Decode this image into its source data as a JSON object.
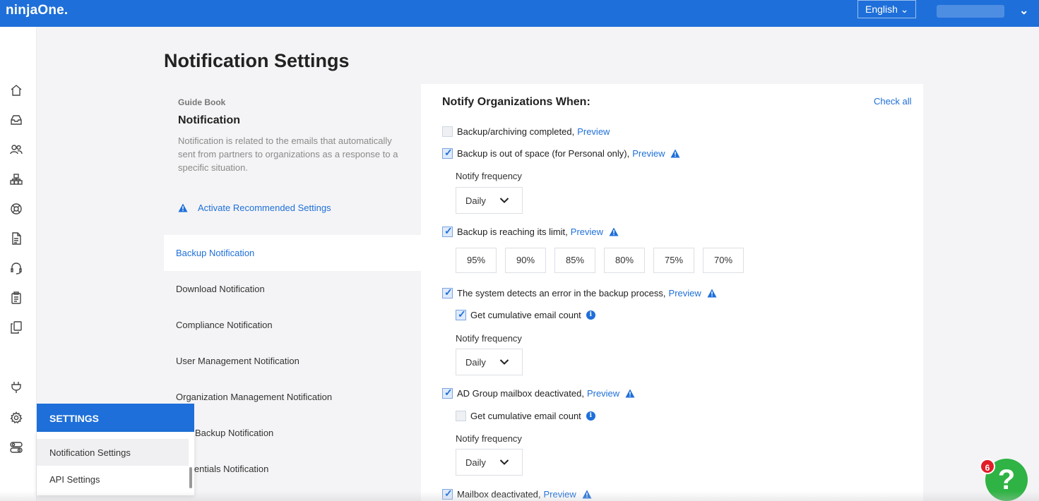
{
  "app": {
    "logo": "ninjaOne."
  },
  "header": {
    "language": "English ⌄"
  },
  "page": {
    "title": "Notification Settings"
  },
  "guide": {
    "label": "Guide Book",
    "heading": "Notification",
    "description": "Notification is related to the emails that automatically sent from partners to organizations as a response to a specific situation.",
    "activate_link": "Activate Recommended Settings"
  },
  "categories": [
    {
      "label": "Backup Notification",
      "active": true
    },
    {
      "label": "Download Notification"
    },
    {
      "label": "Compliance Notification"
    },
    {
      "label": "User Management Notification"
    },
    {
      "label": "Organization Management Notification"
    },
    {
      "label": "Backup Notification"
    },
    {
      "label": "lentials Notification"
    }
  ],
  "panel": {
    "title": "Notify Organizations When:",
    "check_all": "Check all",
    "preview": "Preview",
    "items": {
      "archiving": "Backup/archiving completed,",
      "out_of_space": "Backup is out of space (for Personal only),",
      "reaching_limit": "Backup is reaching its limit,",
      "error_detected": "The system detects an error in the backup process,",
      "cumulative": "Get cumulative email count",
      "ad_group": "AD Group mailbox deactivated,",
      "cumulative2": "Get cumulative email count",
      "mailbox": "Mailbox deactivated,"
    },
    "notify_frequency_label": "Notify frequency",
    "frequency_value": "Daily",
    "thresholds": [
      "95%",
      "90%",
      "85%",
      "80%",
      "75%",
      "70%"
    ]
  },
  "settings_menu": {
    "title": "SETTINGS",
    "items": [
      "Notification Settings",
      "API Settings"
    ]
  },
  "help": {
    "badge": "6",
    "icon_text": "?"
  },
  "colors": {
    "brand_blue": "#1e6fd9",
    "help_green": "#2fb344",
    "badge_red": "#e11d2a"
  }
}
